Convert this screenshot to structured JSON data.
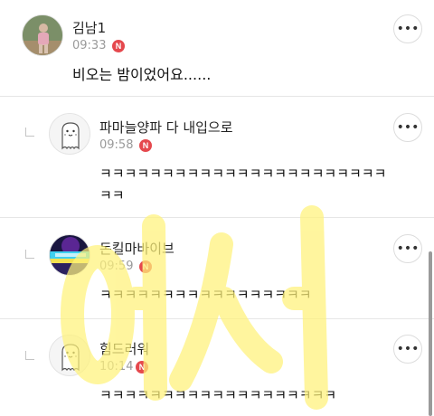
{
  "comments": [
    {
      "nickname": "김남1",
      "time": "09:33",
      "badge": "N",
      "text": "비오는 밤이었어요......",
      "more_icon": "more-horizontal-icon"
    }
  ],
  "replies": [
    {
      "nickname": "파마늘양파 다 내입으로",
      "time": "09:58",
      "badge": "N",
      "text_line1": "ㅋㅋㅋㅋㅋㅋㅋㅋㅋㅋㅋㅋㅋㅋㅋㅋㅋㅋㅋㅋㅋㅋㅋ",
      "text_line2": "ㅋㅋ",
      "more_icon": "more-horizontal-icon"
    },
    {
      "nickname": "돈킬마바이브",
      "time": "09:59",
      "badge": "N",
      "text": "ㅋㅋㅋㅋㅋㅋㅋㅋㅋㅋㅋㅋㅋㅋㅋㅋㅋ",
      "more_icon": "more-horizontal-icon"
    },
    {
      "nickname": "힘드러워",
      "time": "10:14",
      "badge": "N",
      "text": "ㅋㅋㅋㅋㅋㅋㅋㅋㅋㅋㅋㅋㅋㅋㅋㅋㅋㅋㅋ",
      "more_icon": "more-horizontal-icon"
    }
  ],
  "colors": {
    "badge": "#e5484d",
    "watermark": "#fff27a"
  }
}
